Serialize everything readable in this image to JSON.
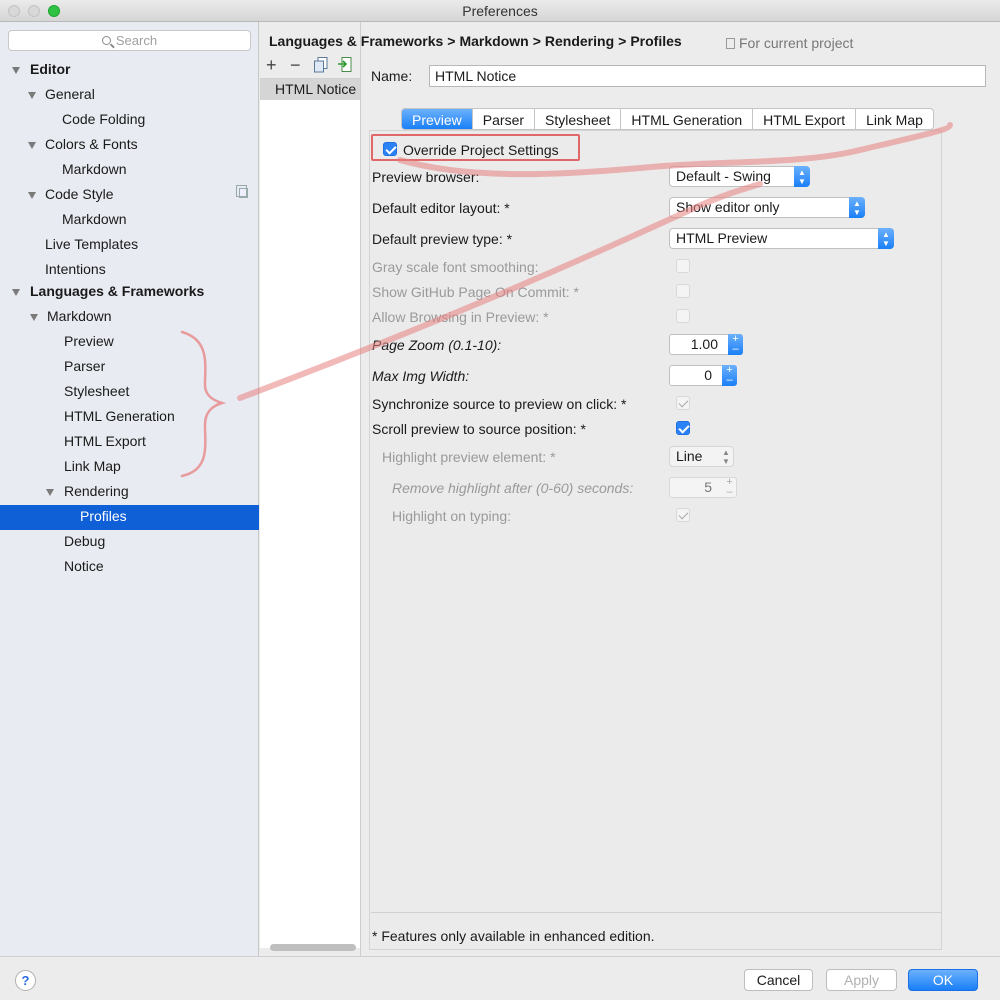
{
  "window": {
    "title": "Preferences"
  },
  "search": {
    "placeholder": "Search"
  },
  "tree": [
    {
      "label": "Editor"
    },
    {
      "label": "General"
    },
    {
      "label": "Code Folding"
    },
    {
      "label": "Colors & Fonts"
    },
    {
      "label": "Markdown"
    },
    {
      "label": "Code Style"
    },
    {
      "label": "Markdown"
    },
    {
      "label": "Live Templates"
    },
    {
      "label": "Intentions"
    },
    {
      "label": "Languages & Frameworks"
    },
    {
      "label": "Markdown"
    },
    {
      "label": "Preview"
    },
    {
      "label": "Parser"
    },
    {
      "label": "Stylesheet"
    },
    {
      "label": "HTML Generation"
    },
    {
      "label": "HTML Export"
    },
    {
      "label": "Link Map"
    },
    {
      "label": "Rendering"
    },
    {
      "label": "Profiles"
    },
    {
      "label": "Debug"
    },
    {
      "label": "Notice"
    }
  ],
  "profiles": {
    "add": "+",
    "remove": "−",
    "items": [
      "HTML Notice"
    ]
  },
  "breadcrumb": [
    "Languages & Frameworks",
    "Markdown",
    "Rendering",
    "Profiles"
  ],
  "breadcrumb_sep": ">",
  "scope": "For current project",
  "name": {
    "label": "Name:",
    "value": "HTML Notice"
  },
  "tabs": [
    "Preview",
    "Parser",
    "Stylesheet",
    "HTML Generation",
    "HTML Export",
    "Link Map"
  ],
  "settings": {
    "override": "Override Project Settings",
    "preview_browser": {
      "label": "Preview browser:",
      "value": "Default - Swing"
    },
    "editor_layout": {
      "label": "Default editor layout: *",
      "value": "Show editor only"
    },
    "preview_type": {
      "label": "Default preview type: *",
      "value": "HTML Preview"
    },
    "gray_scale": "Gray scale font smoothing:",
    "github_page": "Show GitHub Page On Commit: *",
    "allow_browsing": "Allow Browsing in Preview: *",
    "page_zoom": {
      "label": "Page Zoom (0.1-10):",
      "value": "1.00"
    },
    "max_img": {
      "label": "Max Img Width:",
      "value": "0"
    },
    "sync_source": "Synchronize source to preview on click: *",
    "scroll_preview": "Scroll preview to source position: *",
    "highlight_element": {
      "label": "Highlight preview element: *",
      "value": "Line"
    },
    "remove_highlight": {
      "label": "Remove highlight after (0-60) seconds:",
      "value": "5"
    },
    "highlight_typing": "Highlight on typing:"
  },
  "footnote": "* Features only available in enhanced edition.",
  "buttons": {
    "help": "?",
    "cancel": "Cancel",
    "apply": "Apply",
    "ok": "OK"
  },
  "colors": {
    "selection": "#0f5fd6",
    "accent": "#1a7ff7",
    "annotation": "#e06868"
  }
}
